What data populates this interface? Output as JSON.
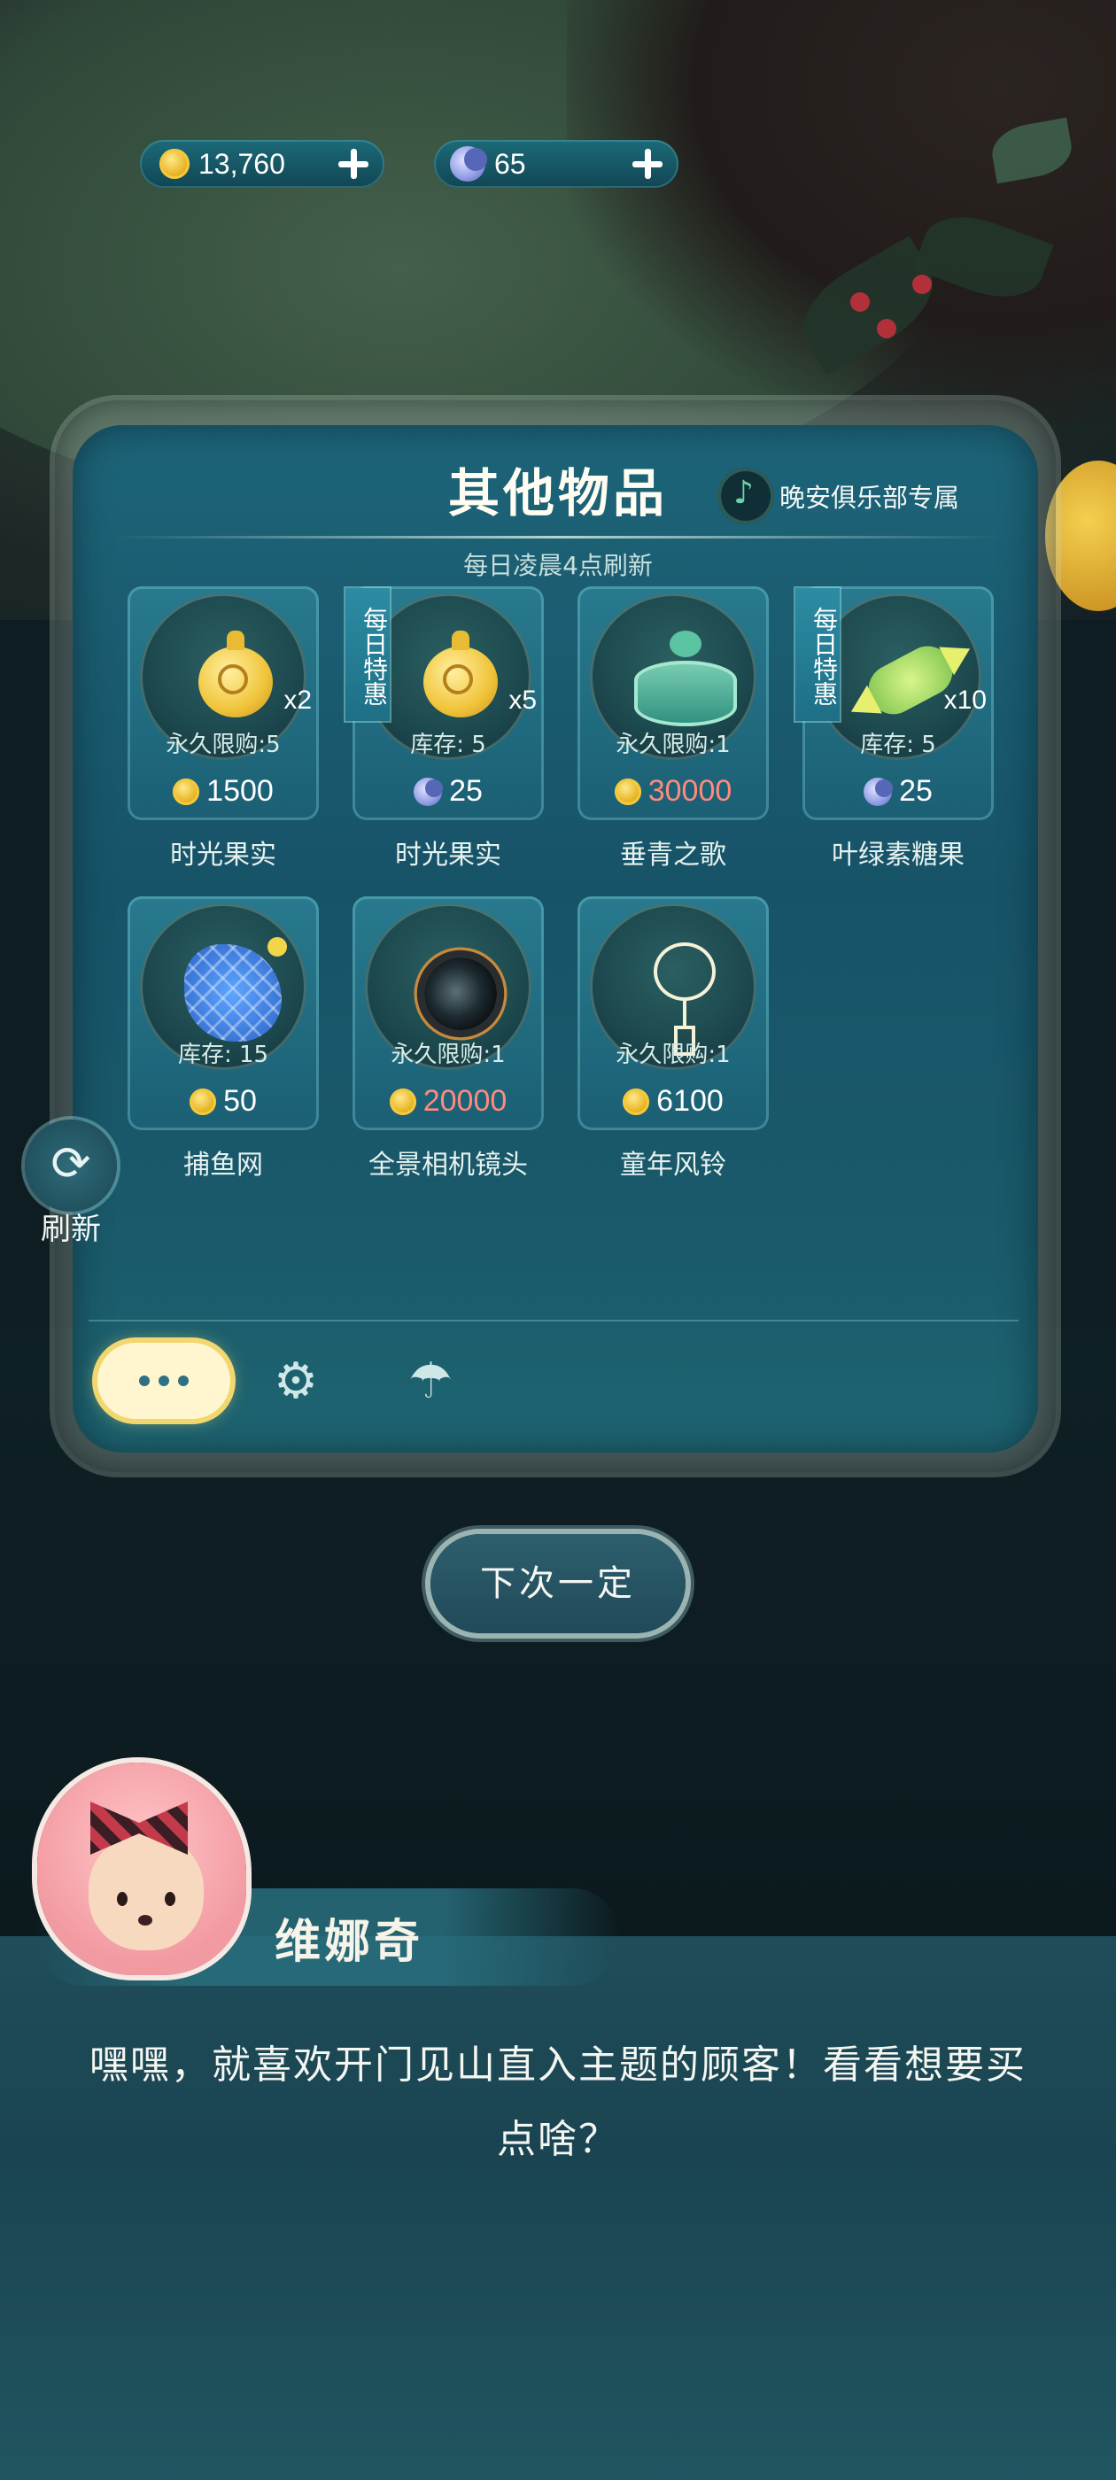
{
  "currency": {
    "coins": "13,760",
    "moons": "65"
  },
  "panel": {
    "title": "其他物品",
    "club_label": "晚安俱乐部专属",
    "refresh_note": "每日凌晨4点刷新"
  },
  "items": [
    {
      "name": "时光果实",
      "limit": "永久限购:5",
      "qty": "x2",
      "price": "1500",
      "currency": "coin",
      "daily": "",
      "icon": "time-fruit-icon"
    },
    {
      "name": "时光果实",
      "limit": "库存: 5",
      "qty": "x5",
      "price": "25",
      "currency": "moon",
      "daily": "每日特惠",
      "icon": "time-fruit-icon"
    },
    {
      "name": "垂青之歌",
      "limit": "永久限购:1",
      "qty": "",
      "price": "30000",
      "currency": "coin",
      "daily": "",
      "icon": "music-box-icon",
      "price_color": "#ff8a7e"
    },
    {
      "name": "叶绿素糖果",
      "limit": "库存: 5",
      "qty": "x10",
      "price": "25",
      "currency": "moon",
      "daily": "每日特惠",
      "icon": "candy-icon"
    },
    {
      "name": "捕鱼网",
      "limit": "库存: 15",
      "qty": "",
      "price": "50",
      "currency": "coin",
      "daily": "",
      "icon": "fishing-net-icon"
    },
    {
      "name": "全景相机镜头",
      "limit": "永久限购:1",
      "qty": "",
      "price": "20000",
      "currency": "coin",
      "daily": "",
      "icon": "camera-lens-icon",
      "price_color": "#ff8a7e"
    },
    {
      "name": "童年风铃",
      "limit": "永久限购:1",
      "qty": "",
      "price": "6100",
      "currency": "coin",
      "daily": "",
      "icon": "wind-chime-icon"
    }
  ],
  "sidebar": {
    "refresh_label": "刷新"
  },
  "buttons": {
    "next_time": "下次一定"
  },
  "dialog": {
    "speaker": "维娜奇",
    "text": "嘿嘿，就喜欢开门见山直入主题的顾客！看看想要买点啥？"
  }
}
